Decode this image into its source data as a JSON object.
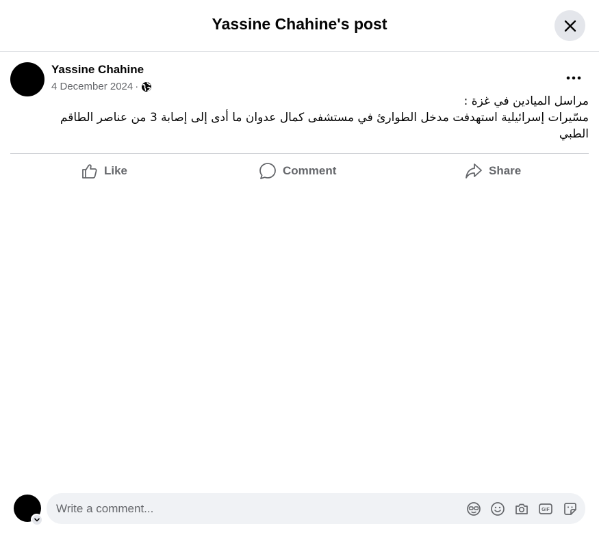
{
  "dialog": {
    "title": "Yassine Chahine's post",
    "close_icon": "close-icon"
  },
  "post": {
    "author": "Yassine Chahine",
    "date": "4 December 2024",
    "separator": "·",
    "privacy_icon": "globe-icon",
    "more_icon": "more-options-icon",
    "text_lines": [
      "مراسل الميادين في غزة :",
      " مسّيرات إسرائيلية استهدفت مدخل الطوارئ في مستشفى كمال عدوان ما أدى إلى إصابة 3 من عناصر الطاقم",
      "الطبي"
    ]
  },
  "actions": {
    "like": "Like",
    "comment": "Comment",
    "share": "Share"
  },
  "composer": {
    "placeholder": "Write a comment...",
    "tools": [
      "avatar-sticker-icon",
      "emoji-icon",
      "camera-icon",
      "gif-icon",
      "sticker-icon"
    ]
  },
  "colors": {
    "text_primary": "#050505",
    "text_secondary": "#65676b",
    "input_background": "#f0f2f5",
    "button_background": "#e4e6eb"
  }
}
